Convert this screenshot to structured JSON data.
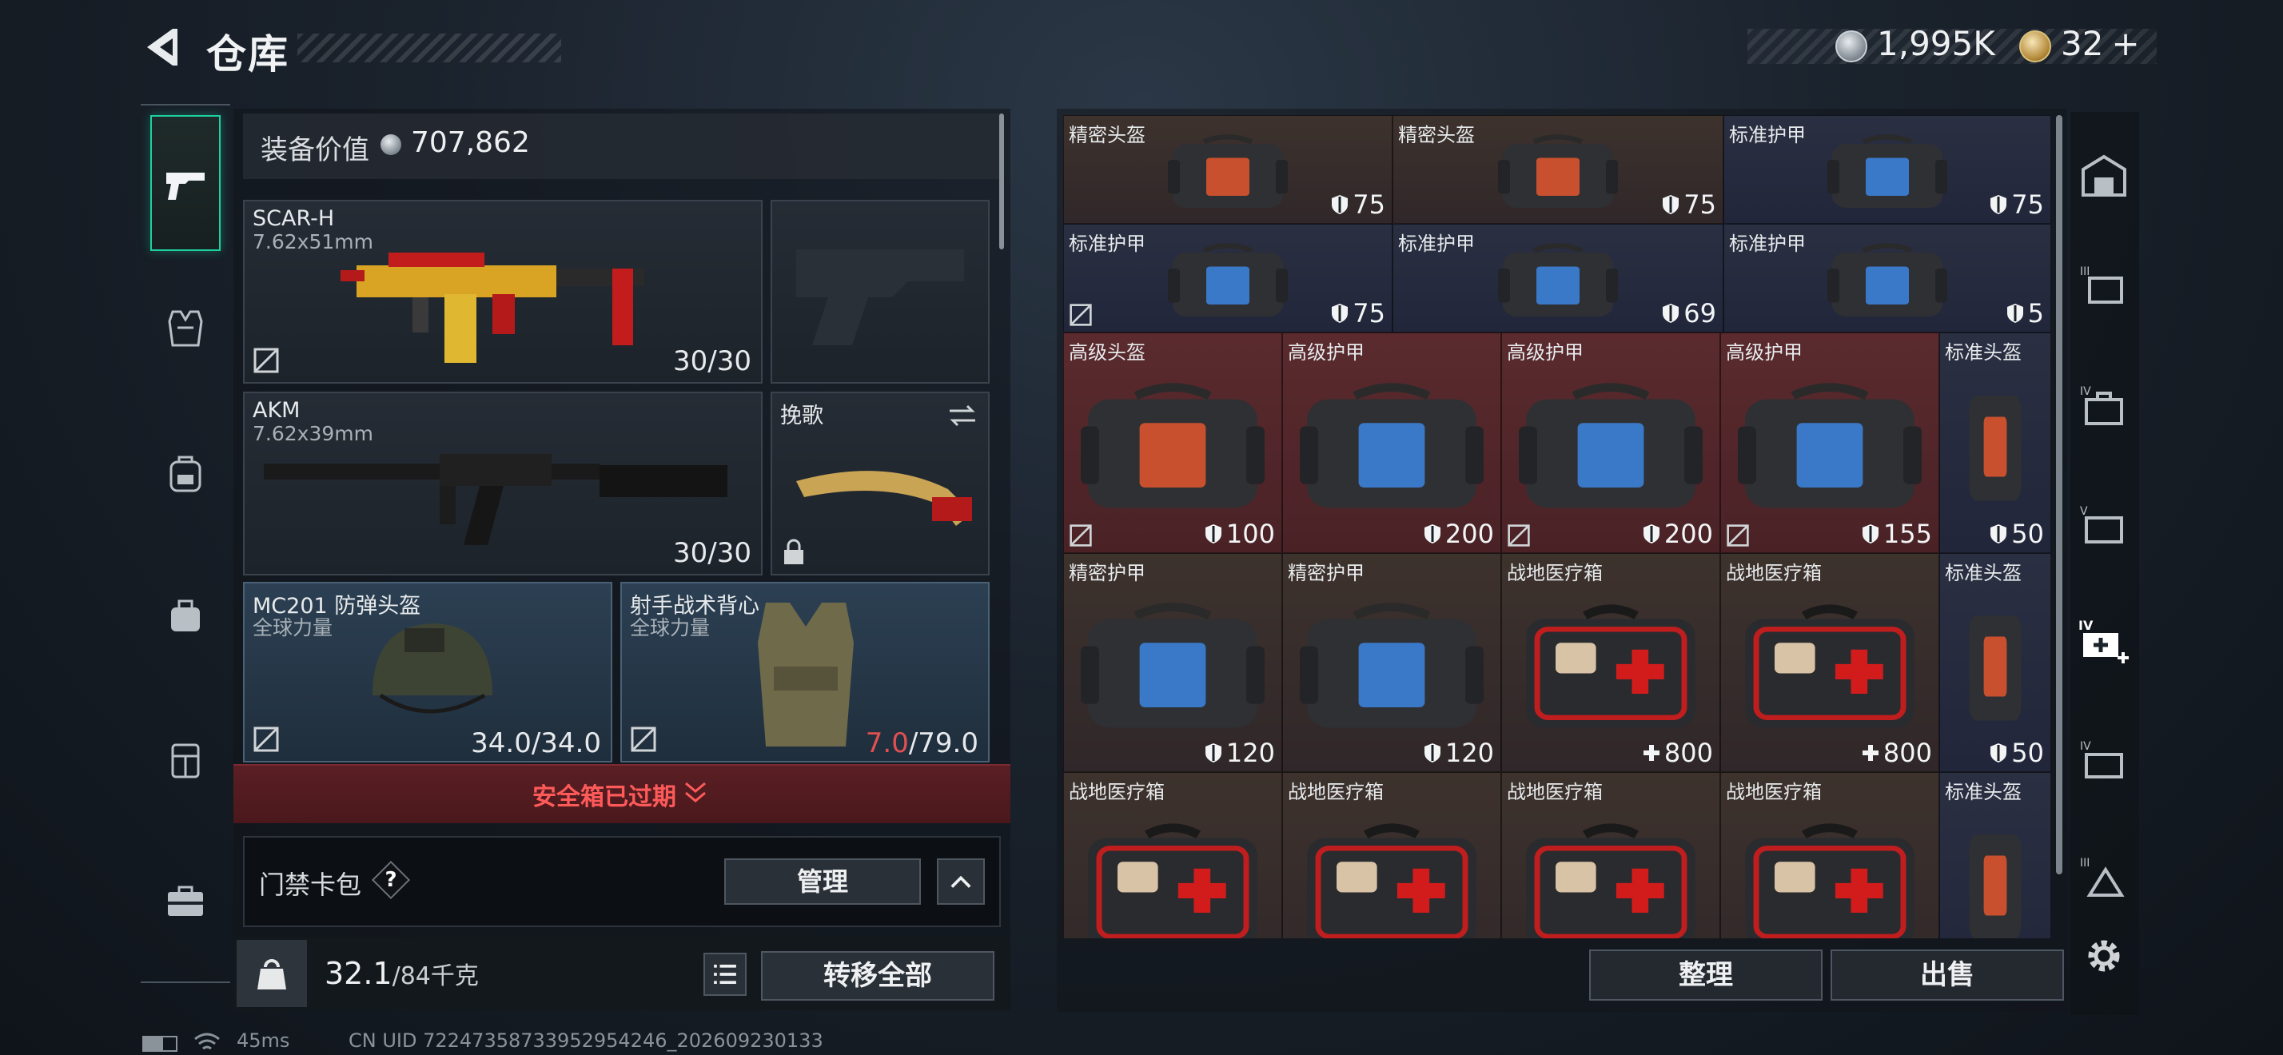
{
  "header": {
    "title": "仓库"
  },
  "currency": {
    "coins": "1,995K",
    "premium": "32",
    "add_label": "+"
  },
  "equipment": {
    "value_label": "装备价值",
    "value": "707,862",
    "slots": [
      {
        "name": "SCAR-H",
        "sub": "7.62x51mm",
        "ammo": "30/30"
      },
      {
        "name": "AKM",
        "sub": "7.62x39mm",
        "ammo": "30/30"
      },
      {
        "name": "挽歌"
      },
      {
        "name": "MC201 防弹头盔",
        "sub": "全球力量",
        "durability": "34.0/34.0"
      },
      {
        "name": "射手战术背心",
        "sub": "全球力量",
        "durability_current": "7.0",
        "durability_max": "/79.0"
      }
    ]
  },
  "safebox": {
    "text": "安全箱已过期"
  },
  "keycard": {
    "label": "门禁卡包",
    "help": "?",
    "manage": "管理"
  },
  "footer_left": {
    "weight": "32.1",
    "weight_unit": "/84千克",
    "transfer_all": "转移全部"
  },
  "items": [
    {
      "name": "精密头盔",
      "value": "75",
      "stat": "shield",
      "color": "brown",
      "art": "bag-red"
    },
    {
      "name": "精密头盔",
      "value": "75",
      "stat": "shield",
      "color": "brown",
      "art": "bag-red"
    },
    {
      "name": "标准护甲",
      "value": "75",
      "stat": "shield",
      "color": "navy",
      "art": "bag-blue"
    },
    {
      "name": "标准护甲",
      "value": "75",
      "stat": "shield",
      "color": "navy",
      "art": "bag-blue",
      "noinsure": true
    },
    {
      "name": "标准护甲",
      "value": "69",
      "stat": "shield",
      "color": "navy",
      "art": "bag-blue"
    },
    {
      "name": "标准护甲",
      "value": "5",
      "stat": "shield",
      "color": "navy",
      "art": "bag-blue"
    },
    {
      "name": "高级头盔",
      "value": "100",
      "stat": "shield",
      "color": "red",
      "art": "bag-red",
      "noinsure": true
    },
    {
      "name": "高级护甲",
      "value": "200",
      "stat": "shield",
      "color": "red",
      "art": "bag-blue"
    },
    {
      "name": "高级护甲",
      "value": "200",
      "stat": "shield",
      "color": "red",
      "art": "bag-blue",
      "noinsure": true
    },
    {
      "name": "高级护甲",
      "value": "155",
      "stat": "shield",
      "color": "red",
      "art": "bag-blue",
      "noinsure": true
    },
    {
      "name": "标准头盔",
      "value": "50",
      "stat": "shield",
      "color": "navy",
      "art": "slim-red"
    },
    {
      "name": "精密护甲",
      "value": "120",
      "stat": "shield",
      "color": "brown",
      "art": "bag-blue"
    },
    {
      "name": "精密护甲",
      "value": "120",
      "stat": "shield",
      "color": "brown",
      "art": "bag-blue"
    },
    {
      "name": "战地医疗箱",
      "value": "800",
      "stat": "heal",
      "color": "brown",
      "art": "medkit"
    },
    {
      "name": "战地医疗箱",
      "value": "800",
      "stat": "heal",
      "color": "brown",
      "art": "medkit"
    },
    {
      "name": "标准头盔",
      "value": "50",
      "stat": "shield",
      "color": "navy",
      "art": "slim-red"
    },
    {
      "name": "战地医疗箱",
      "value": "",
      "stat": "heal",
      "color": "brown",
      "art": "medkit"
    },
    {
      "name": "战地医疗箱",
      "value": "",
      "stat": "heal",
      "color": "brown",
      "art": "medkit"
    },
    {
      "name": "战地医疗箱",
      "value": "",
      "stat": "heal",
      "color": "brown",
      "art": "medkit"
    },
    {
      "name": "战地医疗箱",
      "value": "",
      "stat": "heal",
      "color": "brown",
      "art": "medkit"
    },
    {
      "name": "标准头盔",
      "value": "",
      "stat": "shield",
      "color": "navy",
      "art": "slim-red"
    }
  ],
  "actions": {
    "sort": "整理",
    "sell": "出售"
  },
  "status": {
    "ping": "45ms",
    "uid": "CN UID 72247358733952954246_202609230133"
  },
  "colors": {
    "accent": "#1ed0a0",
    "danger": "#ff5a5a",
    "bg": "#1a222c"
  }
}
